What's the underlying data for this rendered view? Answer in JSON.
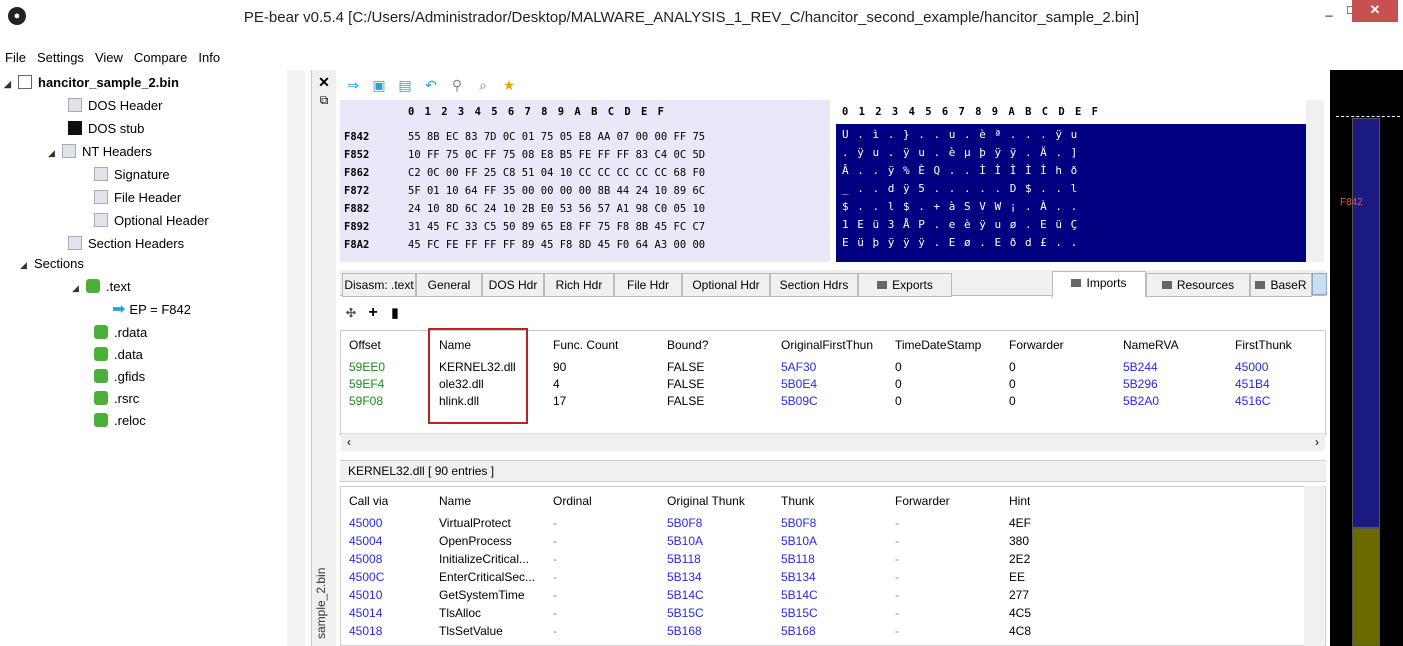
{
  "window": {
    "title": "PE-bear v0.5.4 [C:/Users/Administrador/Desktop/MALWARE_ANALYSIS_1_REV_C/hancitor_second_example/hancitor_sample_2.bin]",
    "minimize": "_",
    "maximize": "□",
    "close": "✕"
  },
  "menu": [
    "File",
    "Settings",
    "View",
    "Compare",
    "Info"
  ],
  "tree": {
    "root": "hancitor_sample_2.bin",
    "dos_header": "DOS Header",
    "dos_stub": "DOS stub",
    "nt_headers": "NT Headers",
    "signature": "Signature",
    "file_header": "File Header",
    "optional_header": "Optional Header",
    "section_headers": "Section Headers",
    "sections": "Sections",
    "text": ".text",
    "ep": "EP = F842",
    "rdata": ".rdata",
    "data": ".data",
    "gfids": ".gfids",
    "rsrc": ".rsrc",
    "reloc": ".reloc"
  },
  "side_tab": "sample_2.bin",
  "hex": {
    "header": "0  1  2  3  4  5  6  7  8  9  A  B  C  D  E  F",
    "ascii_header": "0 1 2 3 4 5 6 7 8 9 A B C D E F",
    "rows": [
      {
        "addr": "F842",
        "bytes": "55 8B EC 83 7D 0C 01 75 05 E8 AA 07 00 00 FF 75",
        "ascii": "U . ì . } . . u . è ª . . . ÿ u"
      },
      {
        "addr": "F852",
        "bytes": "10 FF 75 0C FF 75 08 E8 B5 FE FF FF 83 C4 0C 5D",
        "ascii": ". ÿ u . ÿ u . è µ þ ÿ ÿ . Ä . ]"
      },
      {
        "addr": "F862",
        "bytes": "C2 0C 00 FF 25 C8 51 04 10 CC CC CC CC CC 68 F0",
        "ascii": "Â . . ÿ % È Q . . Ì Ì Ì Ì Ì h ð"
      },
      {
        "addr": "F872",
        "bytes": "5F 01 10 64 FF 35 00 00 00 00 8B 44 24 10 89 6C",
        "ascii": "_ . . d ÿ 5 . . . . . D $ . . l"
      },
      {
        "addr": "F882",
        "bytes": "24 10 8D 6C 24 10 2B E0 53 56 57 A1 98 C0 05 10",
        "ascii": "$ . . l $ . + à S V W ¡ . À . ."
      },
      {
        "addr": "F892",
        "bytes": "31 45 FC 33 C5 50 89 65 E8 FF 75 F8 8B 45 FC C7",
        "ascii": "1 E ü 3 Å P . e è ÿ u ø . E ü Ç"
      },
      {
        "addr": "F8A2",
        "bytes": "45 FC FE FF FF FF 89 45 F8 8D 45 F0 64 A3 00 00",
        "ascii": "E ü þ ÿ ÿ ÿ . E ø . E ð d £ . ."
      }
    ]
  },
  "right_bar_label": "F842",
  "tabs": [
    "Disasm: .text",
    "General",
    "DOS Hdr",
    "Rich Hdr",
    "File Hdr",
    "Optional Hdr",
    "Section Hdrs",
    "Exports",
    "Imports",
    "Resources",
    "BaseR"
  ],
  "imports": {
    "headers": [
      "Offset",
      "Name",
      "Func. Count",
      "Bound?",
      "OriginalFirstThun",
      "TimeDateStamp",
      "Forwarder",
      "NameRVA",
      "FirstThunk"
    ],
    "rows": [
      [
        "59EE0",
        "KERNEL32.dll",
        "90",
        "FALSE",
        "5AF30",
        "0",
        "0",
        "5B244",
        "45000"
      ],
      [
        "59EF4",
        "ole32.dll",
        "4",
        "FALSE",
        "5B0E4",
        "0",
        "0",
        "5B296",
        "451B4"
      ],
      [
        "59F08",
        "hlink.dll",
        "17",
        "FALSE",
        "5B09C",
        "0",
        "0",
        "5B2A0",
        "4516C"
      ]
    ]
  },
  "kernel_label": "KERNEL32.dll   [ 90 entries ]",
  "functions": {
    "headers": [
      "Call via",
      "Name",
      "Ordinal",
      "Original Thunk",
      "Thunk",
      "Forwarder",
      "Hint"
    ],
    "rows": [
      [
        "45000",
        "VirtualProtect",
        "-",
        "5B0F8",
        "5B0F8",
        "-",
        "4EF"
      ],
      [
        "45004",
        "OpenProcess",
        "-",
        "5B10A",
        "5B10A",
        "-",
        "380"
      ],
      [
        "45008",
        "InitializeCritical...",
        "-",
        "5B118",
        "5B118",
        "-",
        "2E2"
      ],
      [
        "4500C",
        "EnterCriticalSec...",
        "-",
        "5B134",
        "5B134",
        "-",
        "EE"
      ],
      [
        "45010",
        "GetSystemTime",
        "-",
        "5B14C",
        "5B14C",
        "-",
        "277"
      ],
      [
        "45014",
        "TlsAlloc",
        "-",
        "5B15C",
        "5B15C",
        "-",
        "4C5"
      ],
      [
        "45018",
        "TlsSetValue",
        "-",
        "5B168",
        "5B168",
        "-",
        "4C8"
      ]
    ]
  }
}
